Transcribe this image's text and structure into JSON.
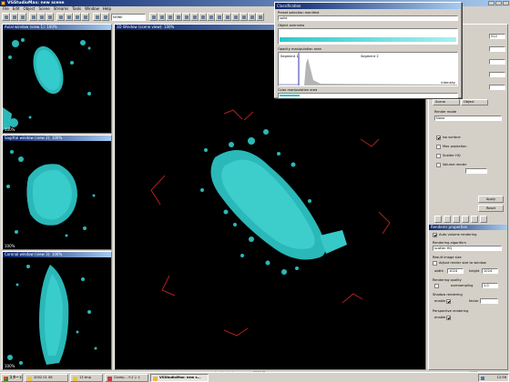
{
  "app": {
    "title": "VGStudioMax: new scene",
    "icon": "app-icon"
  },
  "menu": [
    "File",
    "Edit",
    "Object",
    "Scene",
    "Streams",
    "Tools",
    "Window",
    "Help"
  ],
  "toolbar": {
    "mode_select": "NONE"
  },
  "views": {
    "axial": {
      "title": "Axial window (view 1): 100%",
      "gpt": "100%"
    },
    "sagittal": {
      "title": "Sagittal window (view 2): 100%",
      "gpt": "100%"
    },
    "coronal": {
      "title": "Coronal window (view 3): 100%",
      "gpt": "100%"
    },
    "three_d": {
      "title": "3D Window (scene view): 100%"
    }
  },
  "classification": {
    "title": "Classification",
    "preset_label": "Preset selection manifest",
    "preset_value": "solid",
    "object_label": "Object overview",
    "opacity_label": "Opacity manipulation area",
    "segment1": "Segment 1",
    "segment2": "Segment 2",
    "color_label": "Color manipulation area",
    "axis_max": "Intensity",
    "colors": {
      "cyan": "#30c8c8",
      "curve": "#808080"
    }
  },
  "right_panel": {
    "width_value": "512",
    "render_tabs": [
      "Scene",
      "Object"
    ],
    "group_label": "Render mode",
    "mode_value": "None",
    "options": [
      "Iso surface",
      "Max projection",
      "Scatter HQ",
      "Volume render"
    ],
    "button_label": "Apply",
    "button2_label": "Reset"
  },
  "renderer": {
    "title": "Renderer properties",
    "auto_render": "Auto volume rendering",
    "algorithm_label": "Rendering algorithm",
    "algorithm_value": "scatter HQ",
    "image_size_label": "Result image size",
    "adjust_label": "Adjust render size to window",
    "width_label": "width",
    "width_value": "1024",
    "height_label": "height",
    "height_value": "1024",
    "quality_label": "Rendering quality",
    "oversampling_label": "oversampling",
    "oversampling_value": "1.0",
    "shadow_label": "Shadow rendering",
    "enable_label": "enable",
    "color_label": "factor",
    "perspective_label": "Perspective rendering",
    "perspective_enable": "enable"
  },
  "status": {
    "items": [
      "mm",
      "not estimated",
      "3330 ??"
    ],
    "right": "NUM"
  },
  "taskbar": {
    "start": "スタート",
    "items": [
      "2002 01 08",
      "13 tmp",
      "Clomp - ペイント",
      "VGStudioMax: new s..."
    ],
    "clock": "12:56"
  }
}
